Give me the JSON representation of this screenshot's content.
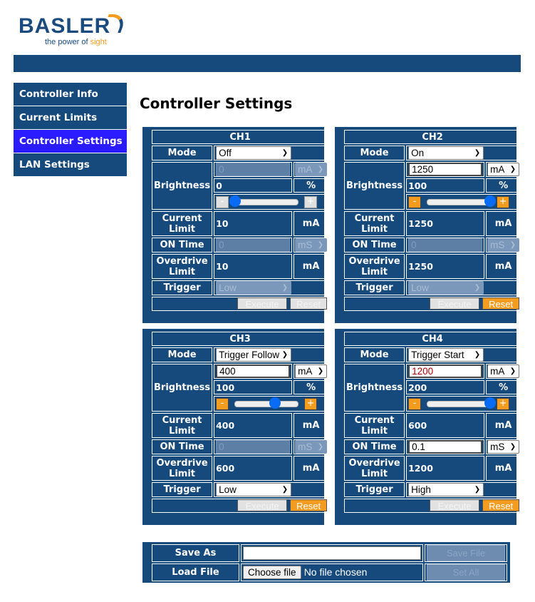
{
  "brand": {
    "name": "BASLER",
    "tagline_main": "the power of",
    "tagline_accent": "sight"
  },
  "colors": {
    "primary": "#174a7c",
    "active_nav": "#2a1cff",
    "accent": "#f39c1f"
  },
  "sidebar": {
    "items": [
      {
        "label": "Controller Info",
        "active": false
      },
      {
        "label": "Current Limits",
        "active": false
      },
      {
        "label": "Controller Settings",
        "active": true
      },
      {
        "label": "LAN Settings",
        "active": false
      }
    ]
  },
  "page_title": "Controller Settings",
  "labels": {
    "mode": "Mode",
    "brightness": "Brightness",
    "current_limit": "Current Limit",
    "on_time": "ON Time",
    "overdrive_limit": "Overdrive Limit",
    "trigger": "Trigger",
    "percent": "%",
    "ma": "mA",
    "minus": "-",
    "plus": "+",
    "execute": "Execute",
    "reset": "Reset"
  },
  "channels": [
    {
      "name": "CH1",
      "mode": "Off",
      "brightness_input": "0",
      "brightness_input_enabled": false,
      "brightness_unit": "mA",
      "brightness_pct": "0",
      "slider_fraction": 0,
      "slider_enabled": false,
      "current_limit": "10",
      "on_time": "0",
      "on_time_enabled": false,
      "on_time_unit": "mS",
      "overdrive_limit": "10",
      "trigger": "Low",
      "trigger_enabled": false,
      "reset_enabled": false
    },
    {
      "name": "CH2",
      "mode": "On",
      "brightness_input": "1250",
      "brightness_input_enabled": true,
      "brightness_unit": "mA",
      "brightness_pct": "100",
      "slider_fraction": 1,
      "slider_enabled": true,
      "current_limit": "1250",
      "on_time": "0",
      "on_time_enabled": false,
      "on_time_unit": "mS",
      "overdrive_limit": "1250",
      "trigger": "Low",
      "trigger_enabled": false,
      "reset_enabled": true
    },
    {
      "name": "CH3",
      "mode": "Trigger Follow",
      "brightness_input": "400",
      "brightness_input_enabled": true,
      "brightness_unit": "mA",
      "brightness_pct": "100",
      "slider_fraction": 0.63,
      "slider_enabled": true,
      "current_limit": "400",
      "on_time": "0",
      "on_time_enabled": false,
      "on_time_unit": "mS",
      "overdrive_limit": "600",
      "trigger": "Low",
      "trigger_enabled": true,
      "reset_enabled": true
    },
    {
      "name": "CH4",
      "mode": "Trigger Start",
      "brightness_input": "1200",
      "brightness_input_enabled": true,
      "brightness_unit": "mA",
      "brightness_pct": "200",
      "slider_fraction": 1,
      "slider_enabled": true,
      "current_limit": "600",
      "on_time": "0.1",
      "on_time_enabled": true,
      "on_time_unit": "mS",
      "overdrive_limit": "1200",
      "trigger": "High",
      "trigger_enabled": true,
      "reset_enabled": true
    }
  ],
  "file": {
    "save_as_label": "Save As",
    "save_as_value": "",
    "save_file": "Save File",
    "load_file_label": "Load File",
    "choose_file": "Choose file",
    "no_file": "No file chosen",
    "set_all": "Set All"
  }
}
